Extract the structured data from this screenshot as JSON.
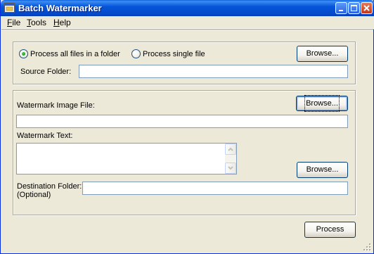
{
  "window": {
    "title": "Batch Watermarker",
    "icon": "app-window-icon"
  },
  "menu": {
    "items": [
      {
        "label_pre": "",
        "label_u": "F",
        "label_post": "ile"
      },
      {
        "label_pre": "",
        "label_u": "T",
        "label_post": "ools"
      },
      {
        "label_pre": "",
        "label_u": "H",
        "label_post": "elp"
      }
    ]
  },
  "source": {
    "radio_all_label": "Process all files in a folder",
    "radio_single_label": "Process single file",
    "selected": "all",
    "browse_label": "Browse...",
    "folder_label": "Source Folder:",
    "folder_value": ""
  },
  "watermark": {
    "image_label": "Watermark Image File:",
    "image_browse_label": "Browse...",
    "image_value": "",
    "text_label": "Watermark Text:",
    "text_value": "",
    "dest_browse_label": "Browse...",
    "dest_label_line1": "Destination Folder:",
    "dest_label_line2": "(Optional)",
    "dest_value": ""
  },
  "actions": {
    "process_label": "Process"
  },
  "colors": {
    "titlebar": "#0655d9",
    "face": "#ece9d8",
    "input_border": "#7f9db9",
    "button_border": "#003c74"
  }
}
